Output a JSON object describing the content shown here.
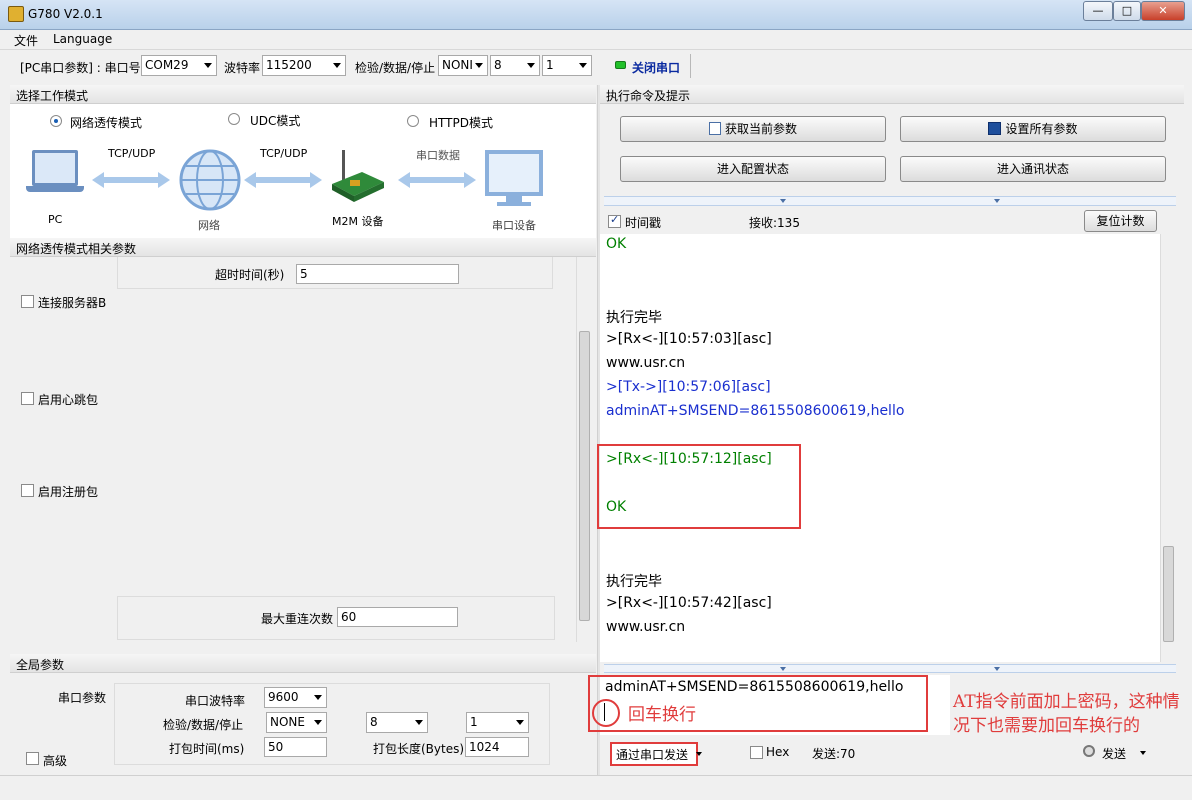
{
  "window": {
    "title": "G780 V2.0.1",
    "min": "—",
    "max": "□",
    "close": "✕"
  },
  "menu": {
    "file": "文件",
    "language": "Language"
  },
  "toolbar": {
    "serial_label": "[PC串口参数] : 串口号",
    "port": "COM29",
    "baud_label": "波特率",
    "baud": "115200",
    "parity_label": "检验/数据/停止",
    "parity": "NONI",
    "databits": "8",
    "stopbits": "1",
    "close_port": "关闭串口"
  },
  "mode_section": {
    "title": "选择工作模式",
    "modes": [
      {
        "label": "网络透传模式",
        "selected": true
      },
      {
        "label": "UDC模式",
        "selected": false
      },
      {
        "label": "HTTPD模式",
        "selected": false
      }
    ],
    "diagram": {
      "pc": "PC",
      "tcpudp1": "TCP/UDP",
      "network": "网络",
      "tcpudp2": "TCP/UDP",
      "m2m": "M2M 设备",
      "serial_data": "串口数据",
      "serial_device": "串口设备"
    }
  },
  "transparent_params": {
    "title": "网络透传模式相关参数",
    "timeout_label": "超时时间(秒)",
    "timeout": "5",
    "connect_b": "连接服务器B",
    "heartbeat": "启用心跳包",
    "register": "启用注册包",
    "max_reconnect_label": "最大重连次数",
    "max_reconnect": "60"
  },
  "global_params": {
    "title": "全局参数",
    "serial_params": "串口参数",
    "baud_label": "串口波特率",
    "baud": "9600",
    "parity_label": "检验/数据/停止",
    "parity": "NONE",
    "databits": "8",
    "stopbits": "1",
    "pack_time_label": "打包时间(ms)",
    "pack_time": "50",
    "pack_len_label": "打包长度(Bytes)",
    "pack_len": "1024",
    "advanced": "高级"
  },
  "right": {
    "title": "执行命令及提示",
    "get_params": "获取当前参数",
    "set_params": "设置所有参数",
    "enter_config": "进入配置状态",
    "enter_comm": "进入通讯状态",
    "timestamp": "时间戳",
    "recv": "接收:135",
    "reset_count": "复位计数",
    "log": [
      {
        "text": "OK",
        "color": "green"
      },
      {
        "text": "执行完毕",
        "color": "black"
      },
      {
        "text": ">[Rx<-][10:57:03][asc]",
        "color": "black"
      },
      {
        "text": "www.usr.cn",
        "color": "black"
      },
      {
        "text": ">[Tx->][10:57:06][asc]",
        "color": "blue"
      },
      {
        "text": "adminAT+SMSEND=8615508600619,hello",
        "color": "blue"
      },
      {
        "text": ">[Rx<-][10:57:12][asc]",
        "color": "green"
      },
      {
        "text": "OK",
        "color": "green"
      },
      {
        "text": "执行完毕",
        "color": "black"
      },
      {
        "text": ">[Rx<-][10:57:42][asc]",
        "color": "black"
      },
      {
        "text": "www.usr.cn",
        "color": "black"
      }
    ],
    "send_text": "adminAT+SMSEND=8615508600619,hello",
    "crlf_note": "回车换行",
    "annotation": "AT指令前面加上密码，这种情况下也需要加回车换行的",
    "send_via": "通过串口发送",
    "hex": "Hex",
    "send_count": "发送:70",
    "send": "发送"
  }
}
